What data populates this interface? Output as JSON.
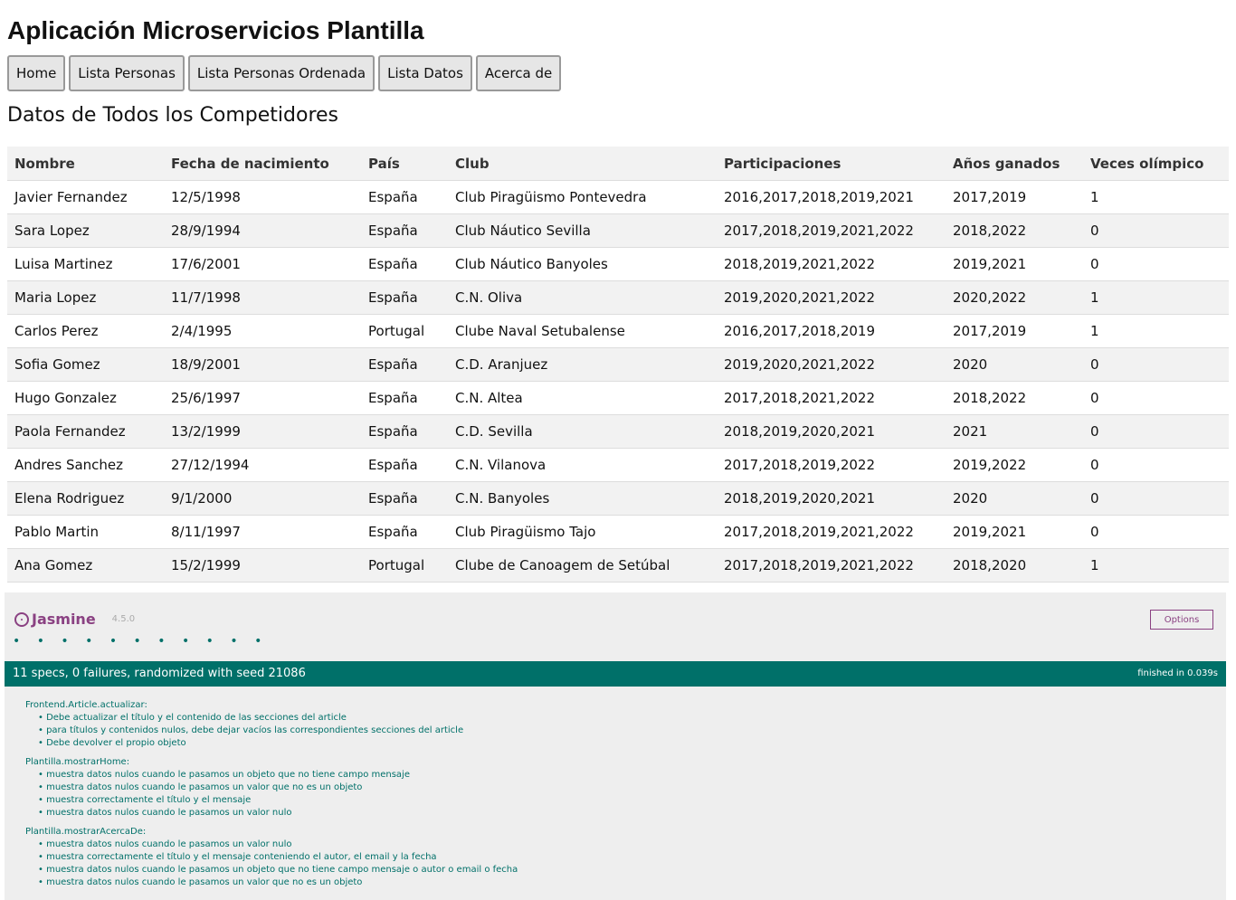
{
  "app_title": "Aplicación Microservicios Plantilla",
  "nav": [
    "Home",
    "Lista Personas",
    "Lista Personas Ordenada",
    "Lista Datos",
    "Acerca de"
  ],
  "section_title": "Datos de Todos los Competidores",
  "table": {
    "headers": [
      "Nombre",
      "Fecha de nacimiento",
      "País",
      "Club",
      "Participaciones",
      "Años ganados",
      "Veces olímpico"
    ],
    "rows": [
      [
        "Javier Fernandez",
        "12/5/1998",
        "España",
        "Club Piragüismo Pontevedra",
        "2016,2017,2018,2019,2021",
        "2017,2019",
        "1"
      ],
      [
        "Sara Lopez",
        "28/9/1994",
        "España",
        "Club Náutico Sevilla",
        "2017,2018,2019,2021,2022",
        "2018,2022",
        "0"
      ],
      [
        "Luisa Martinez",
        "17/6/2001",
        "España",
        "Club Náutico Banyoles",
        "2018,2019,2021,2022",
        "2019,2021",
        "0"
      ],
      [
        "Maria Lopez",
        "11/7/1998",
        "España",
        "C.N. Oliva",
        "2019,2020,2021,2022",
        "2020,2022",
        "1"
      ],
      [
        "Carlos Perez",
        "2/4/1995",
        "Portugal",
        "Clube Naval Setubalense",
        "2016,2017,2018,2019",
        "2017,2019",
        "1"
      ],
      [
        "Sofia Gomez",
        "18/9/2001",
        "España",
        "C.D. Aranjuez",
        "2019,2020,2021,2022",
        "2020",
        "0"
      ],
      [
        "Hugo Gonzalez",
        "25/6/1997",
        "España",
        "C.N. Altea",
        "2017,2018,2021,2022",
        "2018,2022",
        "0"
      ],
      [
        "Paola Fernandez",
        "13/2/1999",
        "España",
        "C.D. Sevilla",
        "2018,2019,2020,2021",
        "2021",
        "0"
      ],
      [
        "Andres Sanchez",
        "27/12/1994",
        "España",
        "C.N. Vilanova",
        "2017,2018,2019,2022",
        "2019,2022",
        "0"
      ],
      [
        "Elena Rodriguez",
        "9/1/2000",
        "España",
        "C.N. Banyoles",
        "2018,2019,2020,2021",
        "2020",
        "0"
      ],
      [
        "Pablo Martin",
        "8/11/1997",
        "España",
        "Club Piragüismo Tajo",
        "2017,2018,2019,2021,2022",
        "2019,2021",
        "0"
      ],
      [
        "Ana Gomez",
        "15/2/1999",
        "Portugal",
        "Clube de Canoagem de Setúbal",
        "2017,2018,2019,2021,2022",
        "2018,2020",
        "1"
      ]
    ]
  },
  "jasmine": {
    "logo": "Jasmine",
    "version": "4.5.0",
    "options_label": "Options",
    "dots": "• • • • • • • • • • •",
    "summary": "11 specs, 0 failures, randomized with seed 21086",
    "duration": "finished in 0.039s",
    "accent_color": "#007069",
    "logo_color": "#8a4182",
    "suites": [
      {
        "name": "Frontend.Article.actualizar:",
        "specs": [
          "Debe actualizar el título y el contenido de las secciones del article",
          "para títulos y contenidos nulos, debe dejar vacíos las correspondientes secciones del article",
          "Debe devolver el propio objeto"
        ]
      },
      {
        "name": "Plantilla.mostrarHome:",
        "specs": [
          "muestra datos nulos cuando le pasamos un objeto que no tiene campo mensaje",
          "muestra datos nulos cuando le pasamos un valor que no es un objeto",
          "muestra correctamente el título y el mensaje",
          "muestra datos nulos cuando le pasamos un valor nulo"
        ]
      },
      {
        "name": "Plantilla.mostrarAcercaDe:",
        "specs": [
          "muestra datos nulos cuando le pasamos un valor nulo",
          "muestra correctamente el título y el mensaje conteniendo el autor, el email y la fecha",
          "muestra datos nulos cuando le pasamos un objeto que no tiene campo mensaje o autor o email o fecha",
          "muestra datos nulos cuando le pasamos un valor que no es un objeto"
        ]
      }
    ]
  }
}
